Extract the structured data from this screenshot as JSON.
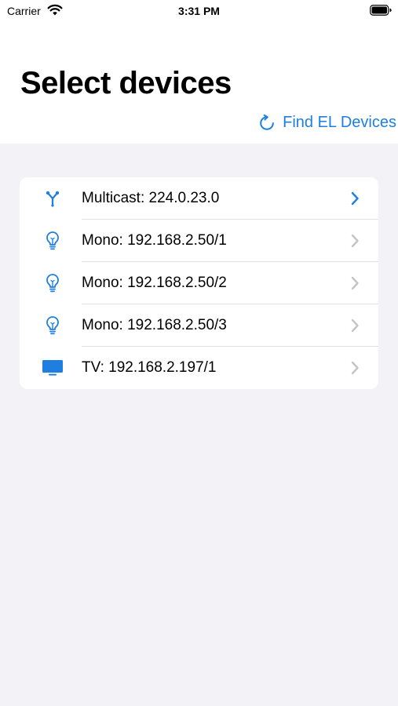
{
  "status_bar": {
    "carrier": "Carrier",
    "time": "3:31 PM"
  },
  "header": {
    "title": "Select devices",
    "find_button_label": "Find EL Devices"
  },
  "colors": {
    "accent": "#1e7fe0",
    "chevron_inactive": "#c4c4c8",
    "background": "#f2f2f7"
  },
  "devices": [
    {
      "label": "Multicast: 224.0.23.0",
      "icon": "multicast-icon",
      "chevron_active": true
    },
    {
      "label": "Mono: 192.168.2.50/1",
      "icon": "lightbulb-icon",
      "chevron_active": false
    },
    {
      "label": "Mono: 192.168.2.50/2",
      "icon": "lightbulb-icon",
      "chevron_active": false
    },
    {
      "label": "Mono: 192.168.2.50/3",
      "icon": "lightbulb-icon",
      "chevron_active": false
    },
    {
      "label": "TV: 192.168.2.197/1",
      "icon": "tv-icon",
      "chevron_active": false
    }
  ]
}
